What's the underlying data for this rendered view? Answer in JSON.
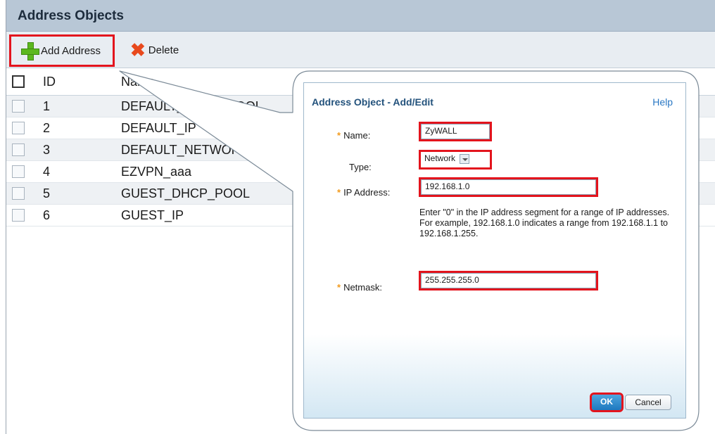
{
  "panel": {
    "title": "Address Objects"
  },
  "toolbar": {
    "add_label": "Add Address",
    "delete_label": "Delete"
  },
  "table": {
    "columns": [
      "ID",
      "Name"
    ],
    "rows": [
      {
        "id": "1",
        "name": "DEFAULT_DHCP_POOL"
      },
      {
        "id": "2",
        "name": "DEFAULT_IP"
      },
      {
        "id": "3",
        "name": "DEFAULT_NETWORK"
      },
      {
        "id": "4",
        "name": "EZVPN_aaa"
      },
      {
        "id": "5",
        "name": "GUEST_DHCP_POOL"
      },
      {
        "id": "6",
        "name": "GUEST_IP"
      }
    ]
  },
  "dialog": {
    "title": "Address Object - Add/Edit",
    "help": "Help",
    "required_mark": "*",
    "name_label": "Name:",
    "name_value": "ZyWALL",
    "type_label": "Type:",
    "type_value": "Network",
    "ip_label": "IP Address:",
    "ip_value": "192.168.1.0",
    "hint_1": "Enter \"0\" in the IP address segment for a range of IP addresses.",
    "hint_2": "For example, 192.168.1.0 indicates a range from 192.168.1.1 to 192.168.1.255.",
    "netmask_label": "Netmask:",
    "netmask_value": "255.255.255.0",
    "ok_label": "OK",
    "cancel_label": "Cancel"
  },
  "colors": {
    "highlight": "#e3141d",
    "header_bg": "#b8c7d6",
    "accent": "#1e78bf",
    "required": "#f29b1d"
  }
}
